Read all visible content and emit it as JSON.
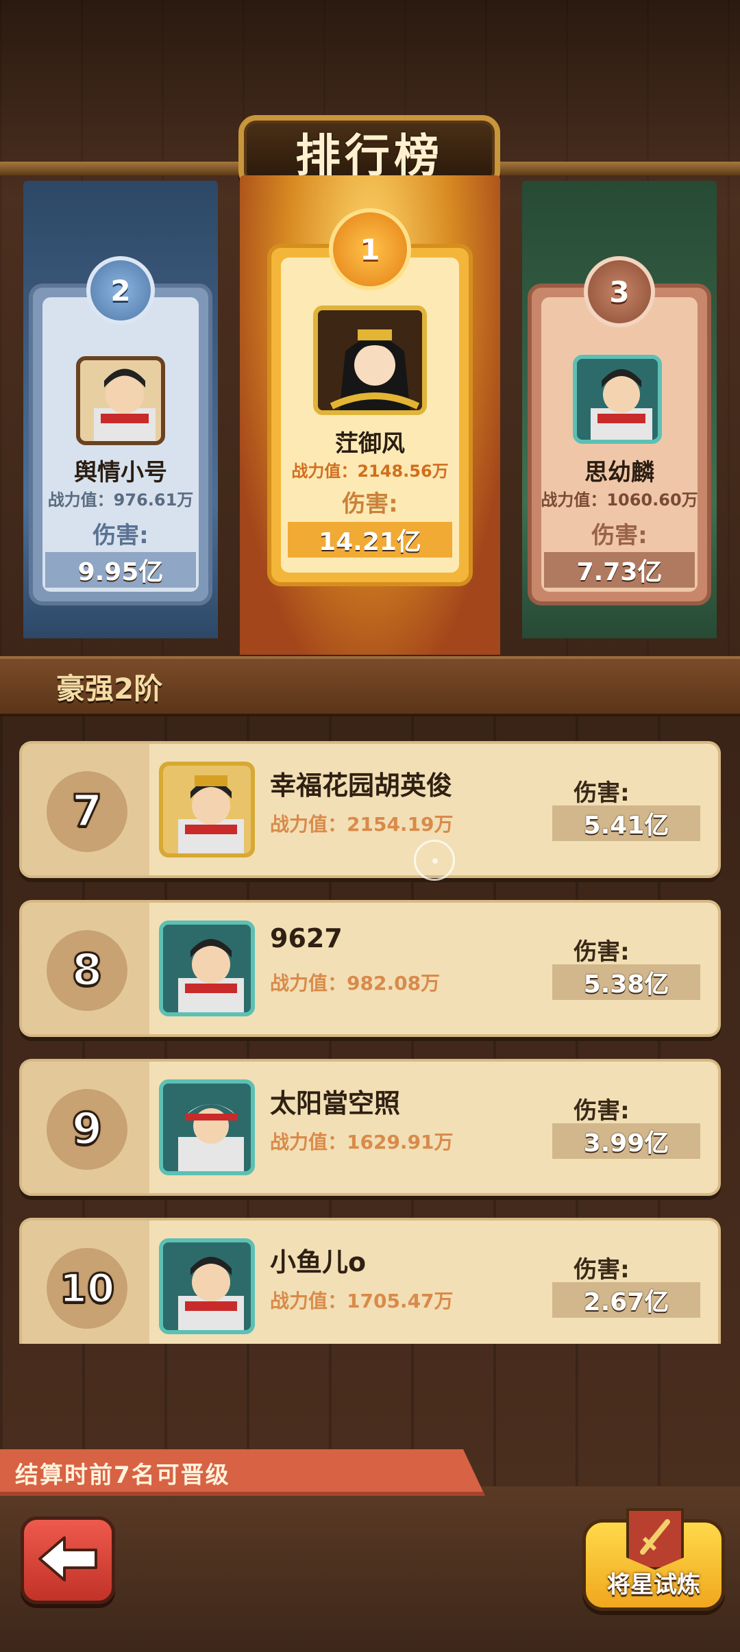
{
  "title": "排行榜",
  "podium": [
    {
      "rank": "2",
      "name": "舆情小号",
      "power": "战力值：976.61万",
      "damage_label": "伤害:",
      "damage": "9.95亿"
    },
    {
      "rank": "1",
      "name": "茳御风",
      "power": "战力值：2148.56万",
      "damage_label": "伤害:",
      "damage": "14.21亿"
    },
    {
      "rank": "3",
      "name": "思幼麟",
      "power": "战力值：1060.60万",
      "damage_label": "伤害:",
      "damage": "7.73亿"
    }
  ],
  "section_title": "豪强2阶",
  "rows": [
    {
      "rank": "7",
      "name": "幸福花园胡英俊",
      "power": "战力值：2154.19万",
      "damage_label": "伤害:",
      "damage": "5.41亿"
    },
    {
      "rank": "8",
      "name": "9627",
      "power": "战力值：982.08万",
      "damage_label": "伤害:",
      "damage": "5.38亿"
    },
    {
      "rank": "9",
      "name": "太阳當空照",
      "power": "战力值：1629.91万",
      "damage_label": "伤害:",
      "damage": "3.99亿"
    },
    {
      "rank": "10",
      "name": "小鱼儿o",
      "power": "战力值：1705.47万",
      "damage_label": "伤害:",
      "damage": "2.67亿"
    }
  ],
  "footer_note": "结算时前7名可晋级",
  "buttons": {
    "trial_label": "将星试炼"
  },
  "icons": {
    "back": "back-arrow-icon",
    "trial": "sword-banner-icon"
  },
  "colors": {
    "gold": "#f3b63a",
    "silver": "#8ea6c4",
    "bronze": "#c8876b",
    "accent_red": "#d86244"
  }
}
